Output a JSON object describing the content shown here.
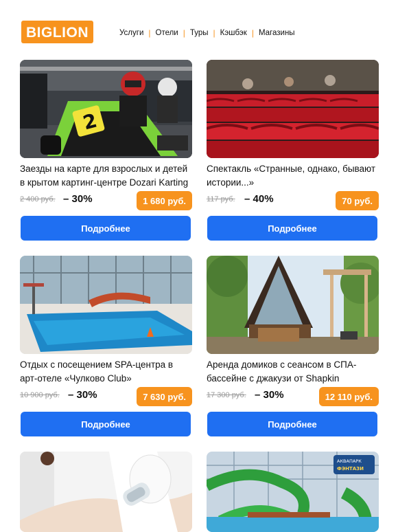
{
  "header": {
    "logo": "BIGLION",
    "nav": [
      {
        "label": "Услуги"
      },
      {
        "label": "Отели"
      },
      {
        "label": "Туры"
      },
      {
        "label": "Кэшбэк"
      },
      {
        "label": "Магазины"
      }
    ],
    "separator": "|"
  },
  "colors": {
    "accent": "#f7931e",
    "button": "#1f6ff2",
    "old_price": "#9a9a9a"
  },
  "cards": [
    {
      "image": "karting-photo",
      "title": "Заезды на карте для взрослых и детей в крытом картинг-центре Dozari Karting",
      "old_price": "2 400 руб.",
      "discount": "– 30%",
      "price": "1 680 руб.",
      "button": "Подробнее"
    },
    {
      "image": "theatre-seats-photo",
      "title": "Спектакль «Странные, однако, бывают истории...»",
      "old_price": "117 руб.",
      "discount": "– 40%",
      "price": "70 руб.",
      "button": "Подробнее"
    },
    {
      "image": "indoor-pool-photo",
      "title": "Отдых с посещением SPA-центра в арт-отеле «Чулково Club»",
      "old_price": "10 900 руб.",
      "discount": "– 30%",
      "price": "7 630 руб.",
      "button": "Подробнее"
    },
    {
      "image": "a-frame-cabin-photo",
      "title": "Аренда домиков с сеансом в СПА-бассейне с джакузи от Shapkin",
      "old_price": "17 300 руб.",
      "discount": "– 30%",
      "price": "12 110 руб.",
      "button": "Подробнее"
    },
    {
      "image": "spa-massage-photo"
    },
    {
      "image": "aquapark-photo",
      "sign_text": "АКВАПАРК ФЭНТАЗИ"
    }
  ]
}
